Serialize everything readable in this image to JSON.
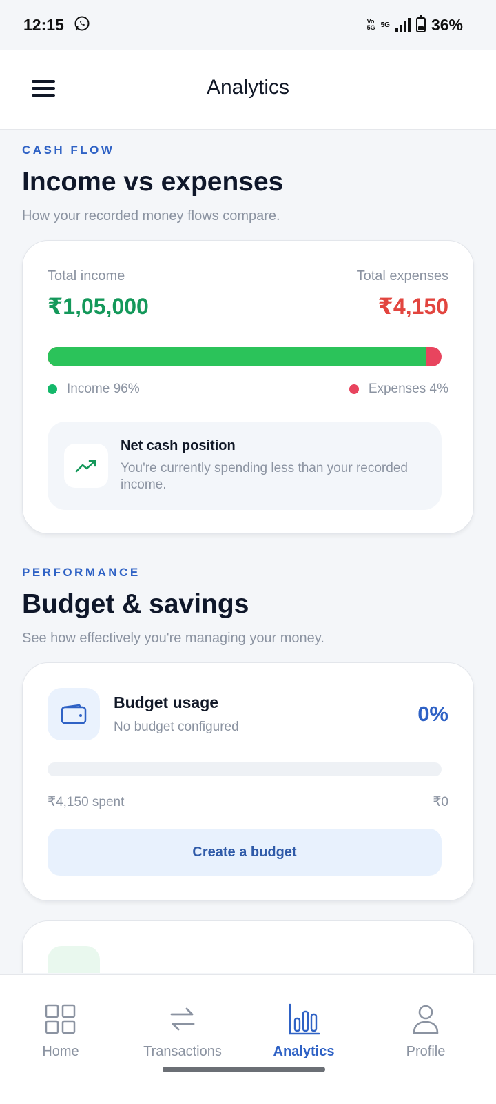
{
  "status_bar": {
    "time": "12:15",
    "volte_top": "Vo",
    "volte_bottom": "5G",
    "network": "5G",
    "battery": "36%",
    "battery_level": 0.36
  },
  "app_bar": {
    "title": "Analytics"
  },
  "cash_flow": {
    "kicker": "CASH FLOW",
    "title": "Income vs expenses",
    "subtitle": "How your recorded money flows compare.",
    "income_label": "Total income",
    "income_value": "₹1,05,000",
    "expense_label": "Total expenses",
    "expense_value": "₹4,150",
    "income_share": 0.96,
    "legend_income": "Income 96%",
    "legend_expenses": "Expenses 4%",
    "net_title": "Net cash position",
    "net_text": "You're currently spending less than your recorded income."
  },
  "performance": {
    "kicker": "PERFORMANCE",
    "title": "Budget & savings",
    "subtitle": "See how effectively you're managing your money.",
    "budget_title": "Budget usage",
    "budget_sub": "No budget configured",
    "budget_pct": "0%",
    "budget_fill": 0,
    "spent": "₹4,150 spent",
    "total": "₹0",
    "create_label": "Create a budget"
  },
  "nav": {
    "items": [
      {
        "label": "Home",
        "icon": "grid-icon"
      },
      {
        "label": "Transactions",
        "icon": "swap-arrows-icon"
      },
      {
        "label": "Analytics",
        "icon": "bar-chart-icon"
      },
      {
        "label": "Profile",
        "icon": "user-icon"
      }
    ],
    "active": "Analytics"
  },
  "colors": {
    "accent": "#2f62c5",
    "income": "#14985a",
    "expense": "#e2453f",
    "income_bar": "#2bc35a",
    "expense_bar": "#e8445e"
  }
}
